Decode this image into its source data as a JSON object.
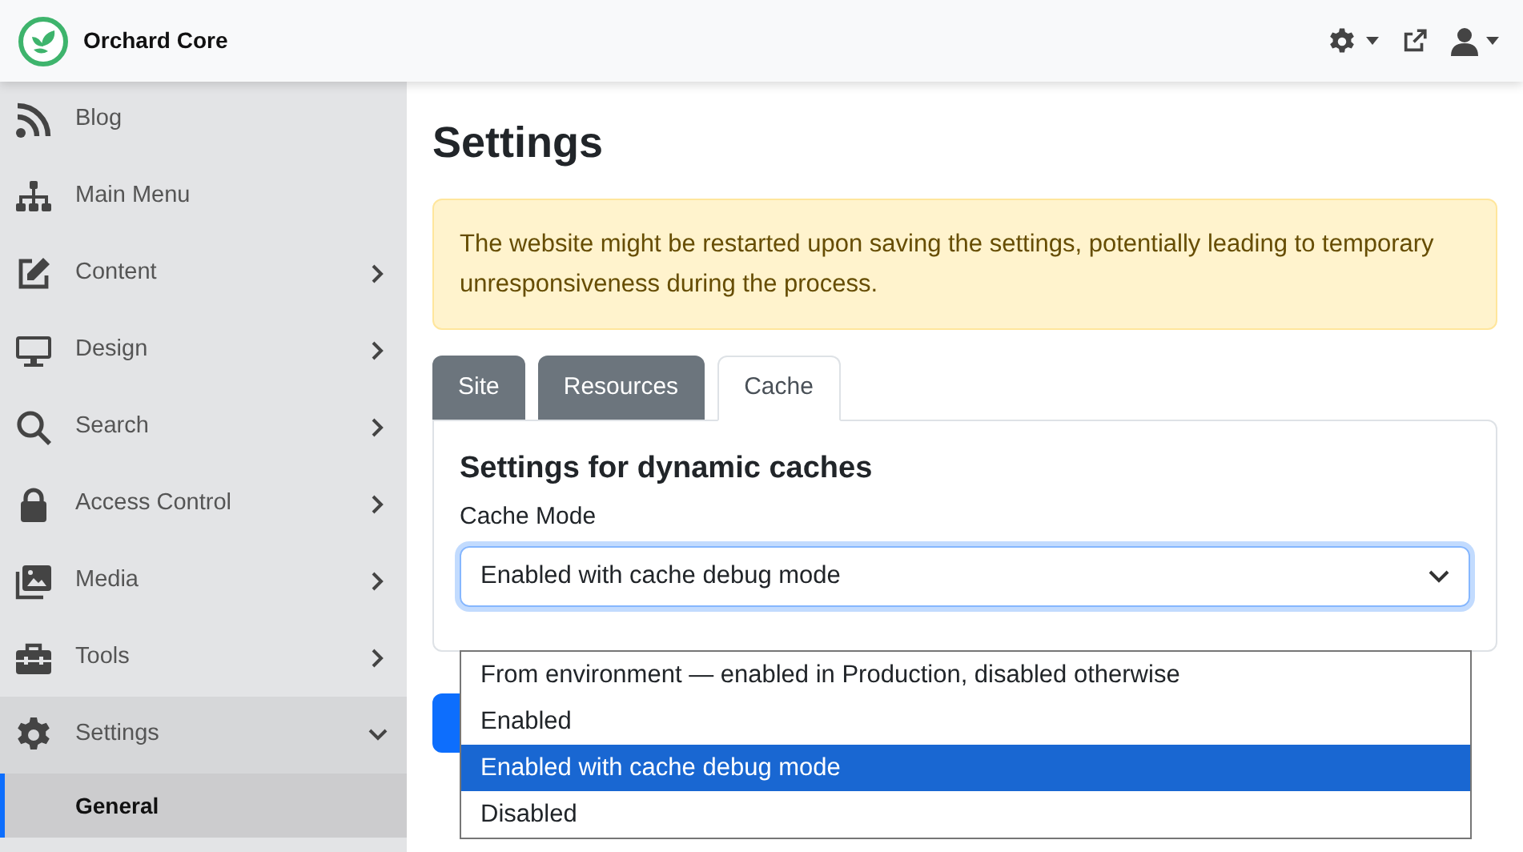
{
  "header": {
    "brand": "Orchard Core"
  },
  "sidebar": {
    "items": [
      {
        "label": "Blog",
        "has_children": false,
        "expanded": false
      },
      {
        "label": "Main Menu",
        "has_children": false,
        "expanded": false
      },
      {
        "label": "Content",
        "has_children": true,
        "expanded": false
      },
      {
        "label": "Design",
        "has_children": true,
        "expanded": false
      },
      {
        "label": "Search",
        "has_children": true,
        "expanded": false
      },
      {
        "label": "Access Control",
        "has_children": true,
        "expanded": false
      },
      {
        "label": "Media",
        "has_children": true,
        "expanded": false
      },
      {
        "label": "Tools",
        "has_children": true,
        "expanded": false
      },
      {
        "label": "Settings",
        "has_children": true,
        "expanded": true,
        "children": [
          {
            "label": "General",
            "selected": true
          }
        ]
      }
    ]
  },
  "page": {
    "title": "Settings",
    "alert": "The website might be restarted upon saving the settings, potentially leading to temporary unresponsiveness during the process.",
    "tabs": [
      {
        "label": "Site",
        "selected": false
      },
      {
        "label": "Resources",
        "selected": false
      },
      {
        "label": "Cache",
        "selected": true
      }
    ],
    "section_title": "Settings for dynamic caches",
    "field_label": "Cache Mode",
    "select": {
      "value": "Enabled with cache debug mode",
      "options": [
        {
          "label": "From environment — enabled in Production, disabled otherwise",
          "selected": false
        },
        {
          "label": "Enabled",
          "selected": false
        },
        {
          "label": "Enabled with cache debug mode",
          "selected": true
        },
        {
          "label": "Disabled",
          "selected": false
        }
      ]
    }
  }
}
